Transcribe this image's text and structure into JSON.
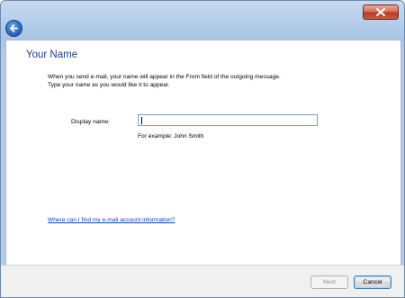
{
  "window": {
    "close_icon": "close-icon",
    "back_icon": "back-arrow-icon"
  },
  "page": {
    "title": "Your Name",
    "instruction_line1": "When you send e-mail, your name will appear in the From field of the outgoing message.",
    "instruction_line2": "Type your name as you would like it to appear."
  },
  "form": {
    "display_name_label": "Display name:",
    "display_name_value": "",
    "example_text": "For example: John Smith"
  },
  "help": {
    "link_text": "Where can I find my e-mail account information?"
  },
  "footer": {
    "next_label": "Next",
    "next_enabled": false,
    "cancel_label": "Cancel"
  },
  "colors": {
    "title": "#1e3f8a",
    "link": "#0a47b5",
    "close_button": "#c95c42"
  }
}
